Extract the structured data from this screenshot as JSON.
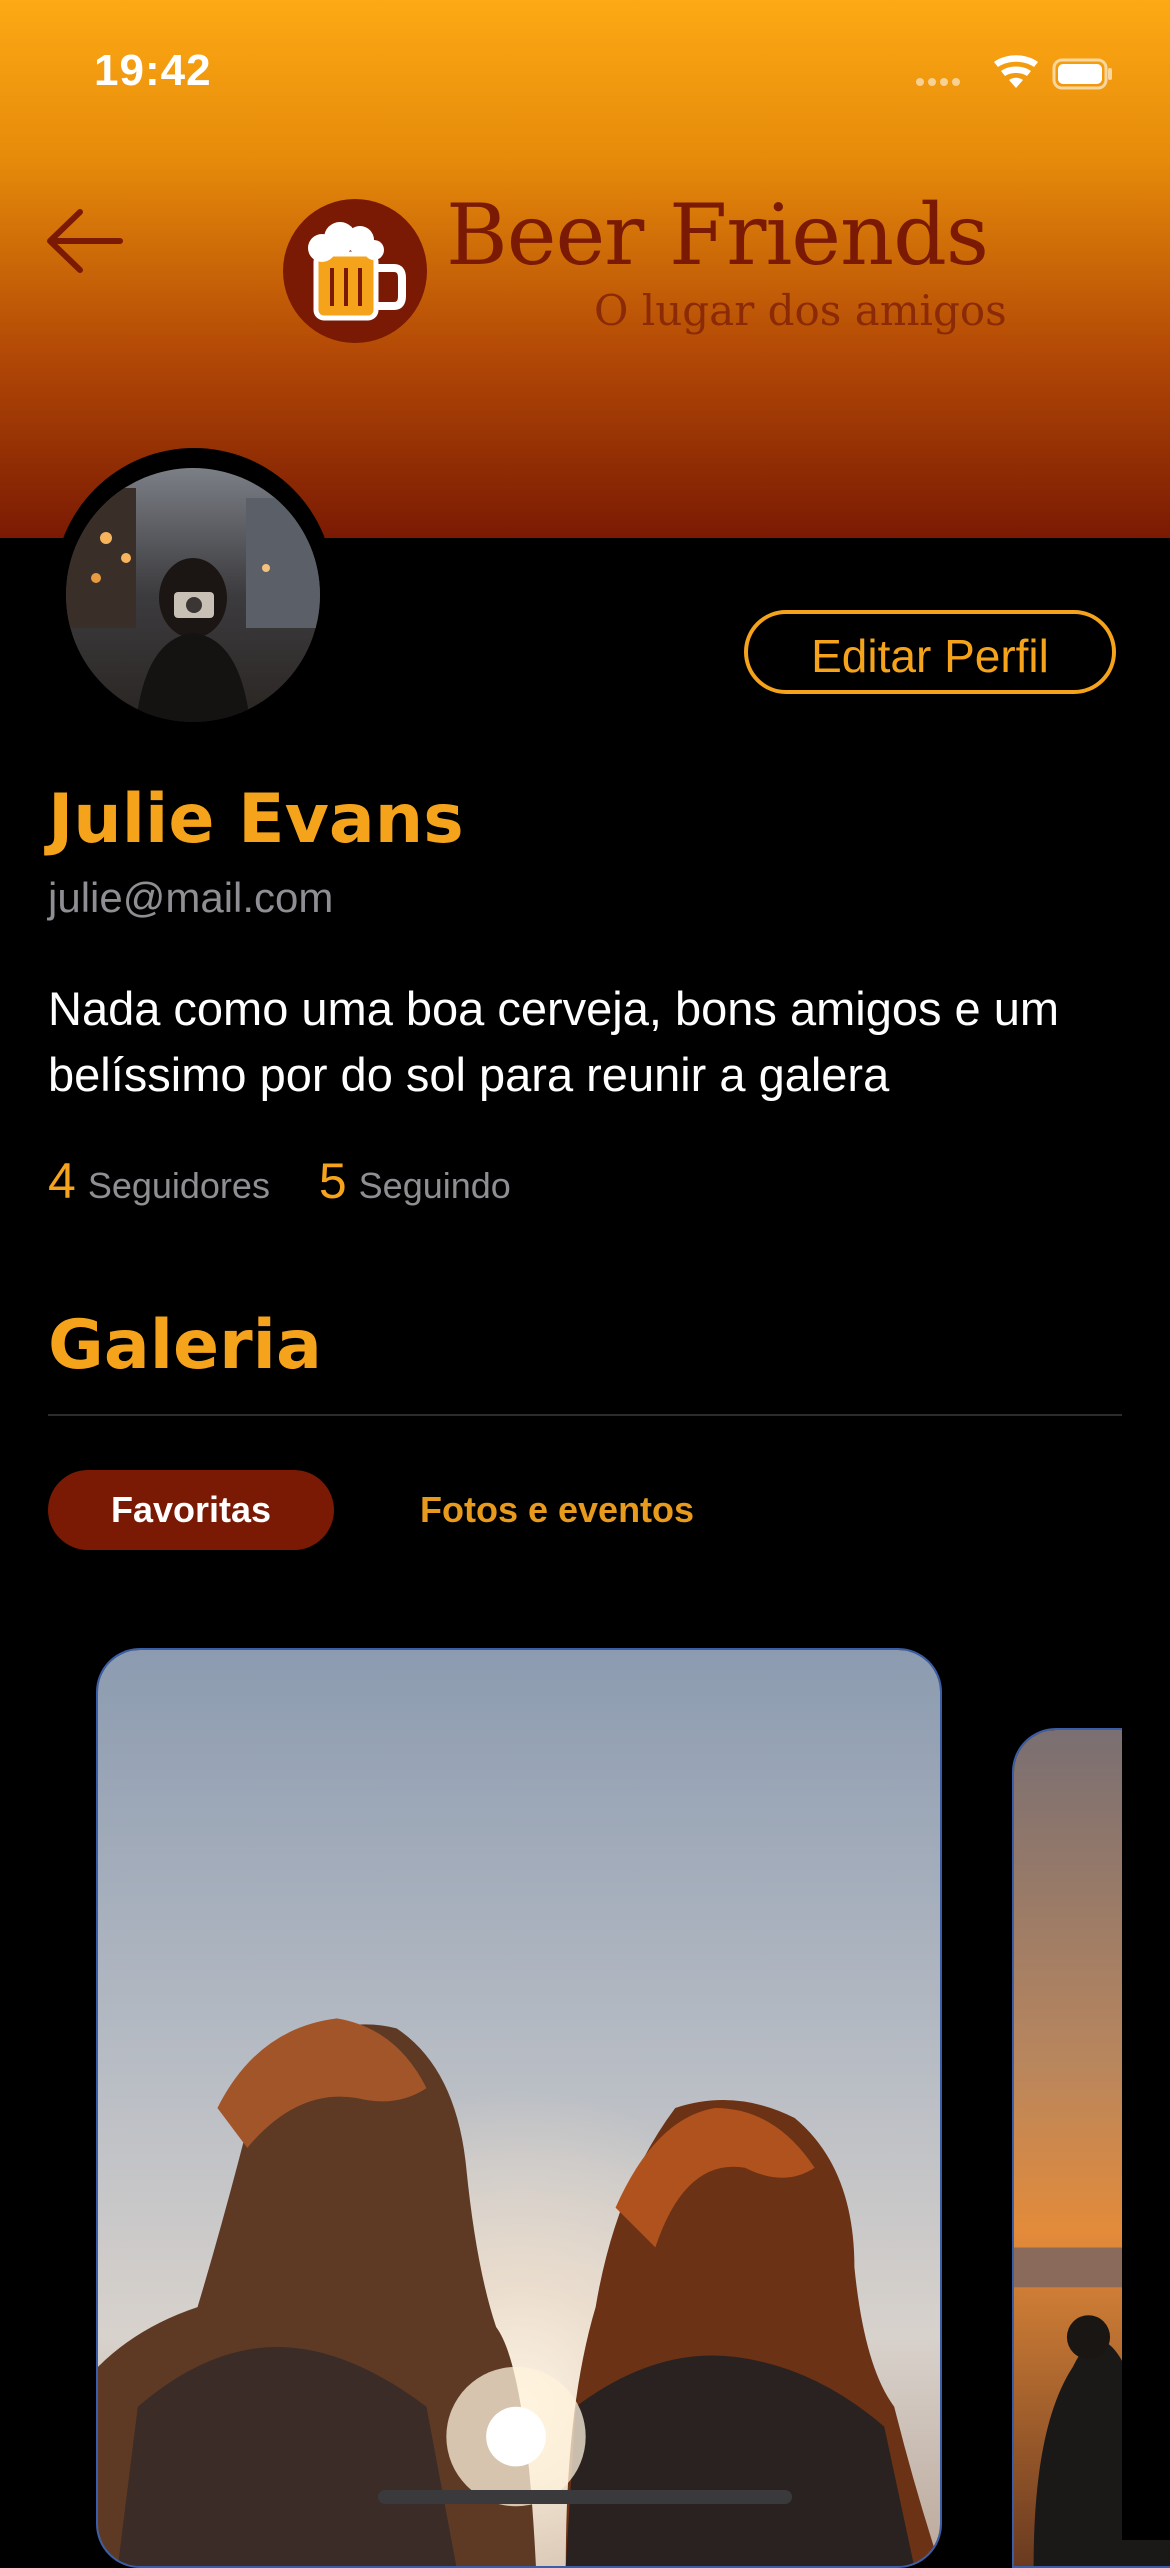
{
  "status_bar": {
    "time": "19:42"
  },
  "header": {
    "brand_name": "Beer Friends",
    "tagline": "O lugar dos amigos",
    "back_icon": "arrow-left-icon",
    "logo_icon": "beer-mug-icon"
  },
  "profile": {
    "name": "Julie Evans",
    "email": "julie@mail.com",
    "bio": "Nada como uma boa cerveja, bons amigos e um belíssimo por do sol para reunir a galera",
    "edit_button_label": "Editar Perfil",
    "followers_count": "4",
    "followers_label": "Seguidores",
    "following_count": "5",
    "following_label": "Seguindo"
  },
  "gallery": {
    "title": "Galeria",
    "tabs": [
      {
        "label": "Favoritas",
        "active": true
      },
      {
        "label": "Fotos e eventos",
        "active": false
      }
    ]
  },
  "colors": {
    "accent": "#f5a31a",
    "brand_dark": "#7a1a05",
    "background": "#000000",
    "muted_text": "#8e8e93"
  }
}
